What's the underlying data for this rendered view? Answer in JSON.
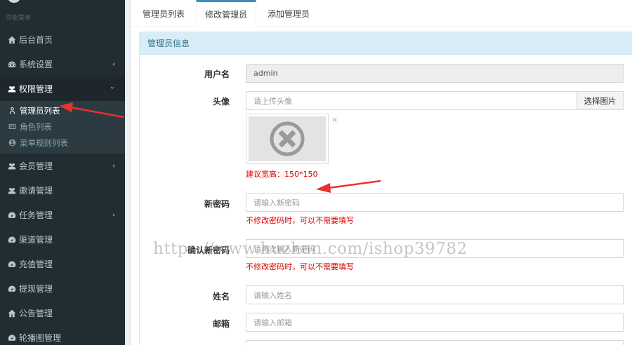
{
  "sidebar": {
    "section_label": "功能菜单",
    "items": [
      {
        "label": "后台首页",
        "icon": "home-icon"
      },
      {
        "label": "系统设置",
        "icon": "dashboard-icon",
        "caret": "‹"
      },
      {
        "label": "权限管理",
        "icon": "users-icon",
        "caret": "⌄"
      },
      {
        "label": "会员管理",
        "icon": "users-icon",
        "caret": "‹"
      },
      {
        "label": "邀请管理",
        "icon": "users-icon"
      },
      {
        "label": "任务管理",
        "icon": "dashboard-icon",
        "caret": "‹"
      },
      {
        "label": "渠道管理",
        "icon": "dashboard-icon"
      },
      {
        "label": "充值管理",
        "icon": "dashboard-icon"
      },
      {
        "label": "提现管理",
        "icon": "dashboard-icon"
      },
      {
        "label": "公告管理",
        "icon": "home-icon"
      },
      {
        "label": "轮播图管理",
        "icon": "dashboard-icon"
      }
    ],
    "submenu": [
      {
        "label": "管理员列表",
        "icon": "user-outline-icon"
      },
      {
        "label": "角色列表",
        "icon": "id-card-icon"
      },
      {
        "label": "菜单规则列表",
        "icon": "user-circle-icon"
      }
    ]
  },
  "tabs": [
    "管理员列表",
    "修改管理员",
    "添加管理员"
  ],
  "box": {
    "title": "管理员信息"
  },
  "form": {
    "username_label": "用户名",
    "username_value": "admin",
    "avatar_label": "头像",
    "avatar_placeholder": "请上传头像",
    "avatar_button": "选择图片",
    "avatar_remove": "×",
    "avatar_hint": "建议宽高：150*150",
    "password_label": "新密码",
    "password_placeholder": "请输入新密码",
    "password_hint": "不修改密码时，可以不需要填写",
    "confirm_label": "确认新密码",
    "confirm_placeholder": "请再次输入新密码",
    "confirm_hint": "不修改密码时，可以不需要填写",
    "name_label": "姓名",
    "name_placeholder": "请输入姓名",
    "email_label": "邮箱",
    "email_placeholder": "请输入邮箱"
  },
  "watermark": "https://www.huzhan.com/ishop39782",
  "colors": {
    "sidebar_bg": "#222d32",
    "accent": "#3c8dbc",
    "header_bg": "#d9edf7",
    "error": "#dd0000",
    "annotation_arrow": "#e8322f"
  }
}
